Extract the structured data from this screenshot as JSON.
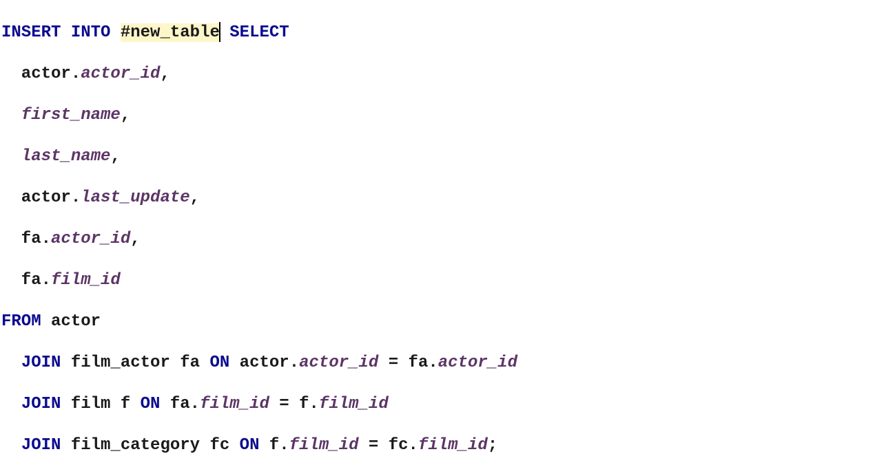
{
  "sql": {
    "insert": "INSERT",
    "into": "INTO",
    "select": "SELECT",
    "from": "FROM",
    "join": "JOIN",
    "on": "ON",
    "target_table": "#new_table",
    "col1_prefix": "  actor.",
    "col1": "actor_id",
    "col2_prefix": "  ",
    "col2": "first_name",
    "col3_prefix": "  ",
    "col3": "last_name",
    "col4_prefix": "  actor.",
    "col4": "last_update",
    "col5_prefix": "  fa.",
    "col5": "actor_id",
    "col6_prefix": "  fa.",
    "col6": "film_id",
    "from_table": " actor",
    "join1_tbl": " film_actor fa ",
    "j1l_pre": " actor.",
    "j1l": "actor_id",
    "j1eq": " = ",
    "j1r_pre": "fa.",
    "j1r": "actor_id",
    "join2_tbl": " film f ",
    "j2l_pre": " fa.",
    "j2l": "film_id",
    "j2eq": " = ",
    "j2r_pre": "f.",
    "j2r": "film_id",
    "join3_tbl": " film_category fc ",
    "j3l_pre": " f.",
    "j3l": "film_id",
    "j3eq": " = ",
    "j3r_pre": "fc.",
    "j3r": "film_id",
    "comma": ",",
    "semi": ";",
    "sp": " ",
    "ind": "  "
  }
}
